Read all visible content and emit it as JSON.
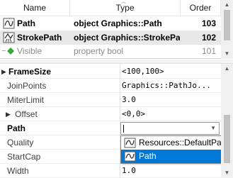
{
  "table": {
    "headers": {
      "name": "Name",
      "type": "Type",
      "order": "Order"
    },
    "rows": [
      {
        "name": "Path",
        "type": "object Graphics::Path",
        "order": "103",
        "icon": "path-icon"
      },
      {
        "name": "StrokePath",
        "type": "object Graphics::StrokePath",
        "order": "102",
        "icon": "stroke-path-icon"
      },
      {
        "name": "Visible",
        "type": "property bool",
        "order": "101",
        "icon": "diamond-icon"
      }
    ]
  },
  "properties": [
    {
      "name": "FrameSize",
      "value": "<100,100>",
      "expander": "▶",
      "bold": true
    },
    {
      "name": "JoinPoints",
      "value": "Graphics::PathJo..."
    },
    {
      "name": "MiterLimit",
      "value": "3.0"
    },
    {
      "name": "Offset",
      "value": "<0,0>",
      "expander": "▶"
    },
    {
      "name": "Path",
      "value": "",
      "bold": true
    },
    {
      "name": "Quality",
      "value": ""
    },
    {
      "name": "StartCap",
      "value": ""
    },
    {
      "name": "Width",
      "value": "1.0"
    }
  ],
  "dropdown": {
    "options": [
      {
        "label": "Resources::DefaultPath",
        "selected": false
      },
      {
        "label": "Path",
        "selected": true
      }
    ]
  },
  "colors": {
    "selection": "#0078d7",
    "accent_green": "#3aa63a"
  }
}
